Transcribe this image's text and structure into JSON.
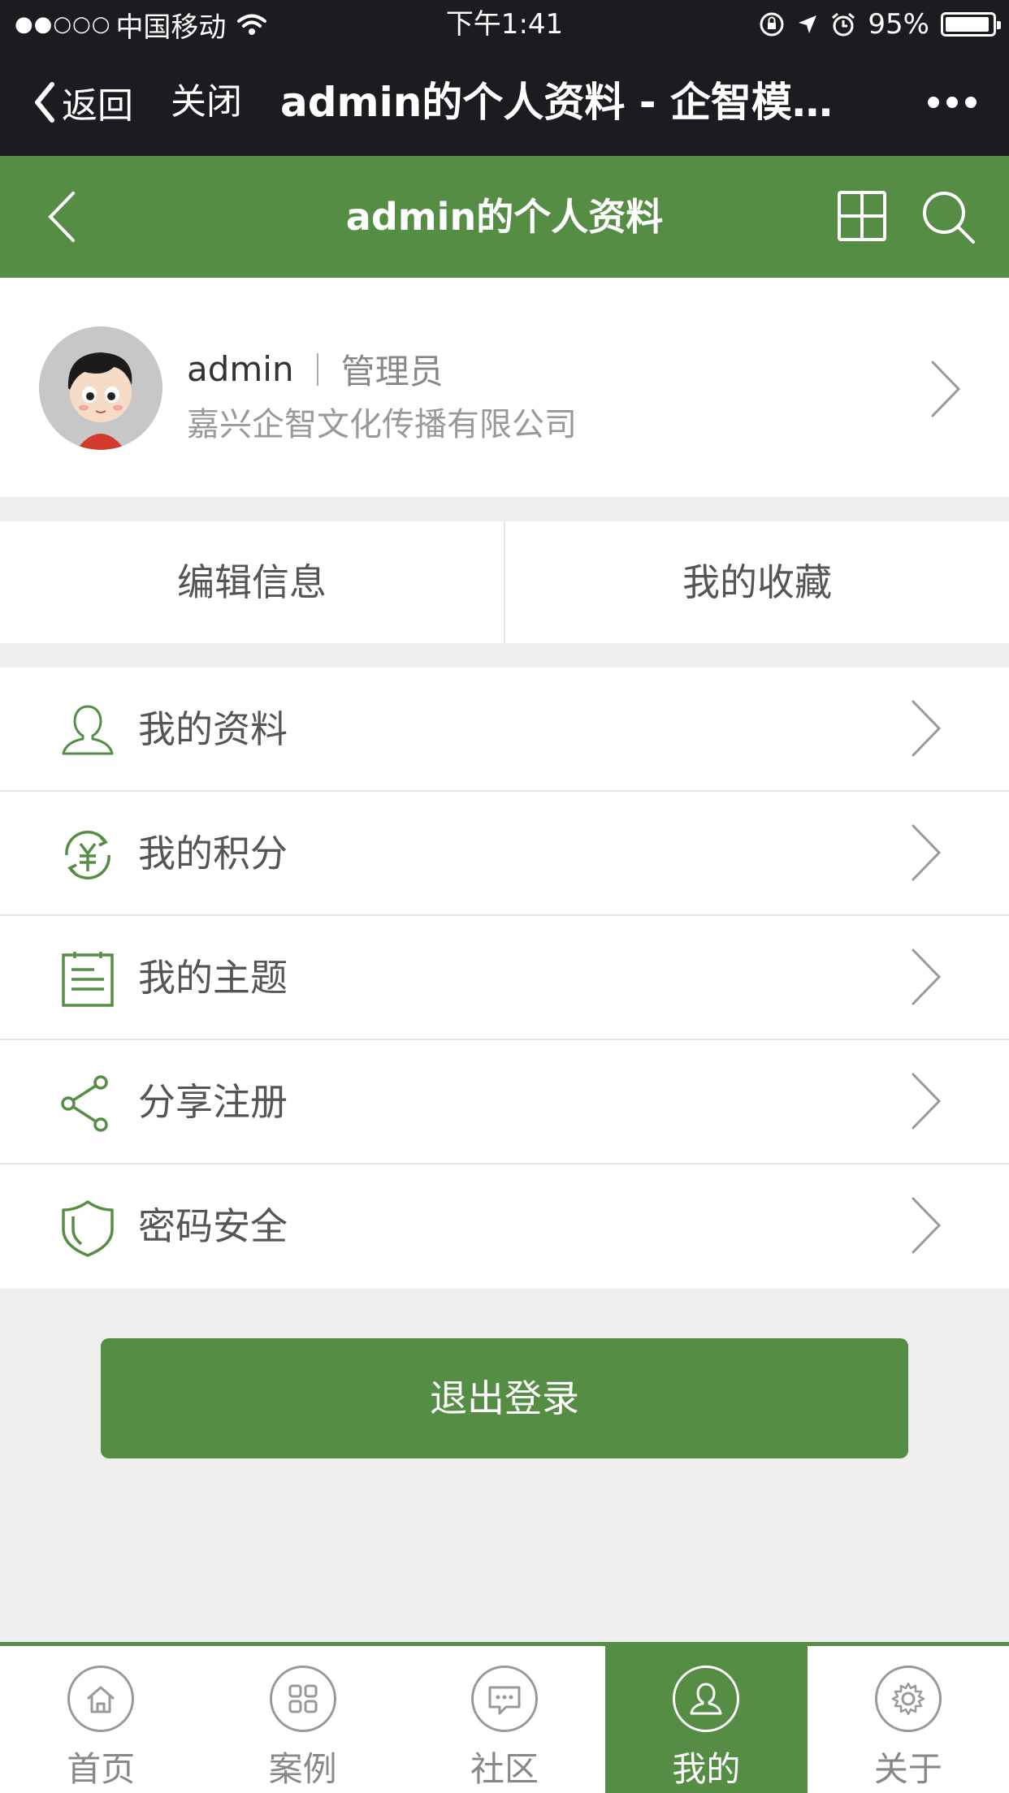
{
  "status_bar": {
    "signal_dots": "●●○○○",
    "carrier": "中国移动",
    "time": "下午1:41",
    "battery": "95%",
    "battery_level": 0.95
  },
  "wechat_nav": {
    "back_label": "返回",
    "close_label": "关闭",
    "title": "admin的个人资料 - 企智模…"
  },
  "header": {
    "title": "admin的个人资料"
  },
  "profile": {
    "username": "admin",
    "role": "管理员",
    "company": "嘉兴企智文化传播有限公司"
  },
  "tabs": [
    {
      "label": "编辑信息"
    },
    {
      "label": "我的收藏"
    }
  ],
  "menu": [
    {
      "label": "我的资料",
      "icon": "user-icon"
    },
    {
      "label": "我的积分",
      "icon": "points-icon"
    },
    {
      "label": "我的主题",
      "icon": "document-icon"
    },
    {
      "label": "分享注册",
      "icon": "share-icon"
    },
    {
      "label": "密码安全",
      "icon": "shield-icon"
    }
  ],
  "logout_label": "退出登录",
  "tabbar": [
    {
      "label": "首页",
      "icon": "home-icon",
      "active": false
    },
    {
      "label": "案例",
      "icon": "grid-icon",
      "active": false
    },
    {
      "label": "社区",
      "icon": "chat-icon",
      "active": false
    },
    {
      "label": "我的",
      "icon": "user-icon",
      "active": true
    },
    {
      "label": "关于",
      "icon": "gear-icon",
      "active": false
    }
  ],
  "colors": {
    "brand_green": "#568d45",
    "dark_bar": "#1a1c20",
    "page_bg": "#efefef"
  }
}
